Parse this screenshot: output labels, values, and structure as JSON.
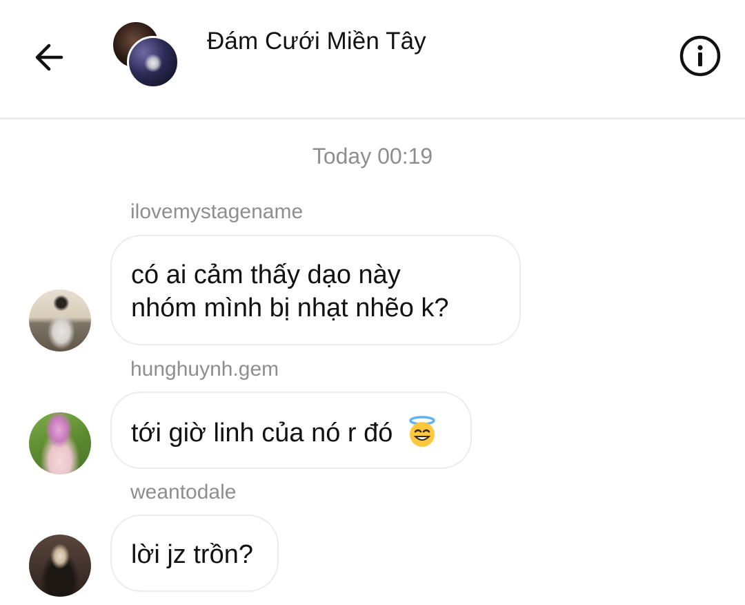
{
  "header": {
    "title": "Đám Cưới Miền Tây",
    "back_icon": "arrow-left-icon",
    "info_icon": "info-icon"
  },
  "timestamp": "Today 00:19",
  "messages": [
    {
      "username": "ilovemystagename",
      "lines": [
        "có ai cảm thấy dạo này",
        "nhóm mình bị nhạt nhẽo k?"
      ]
    },
    {
      "username": "hunghuynh.gem",
      "lines": [
        "tới giờ linh của nó r đó"
      ],
      "emoji": "😇"
    },
    {
      "username": "weantodale",
      "lines": [
        "lời jz trồn?"
      ]
    }
  ],
  "colors": {
    "text": "#111111",
    "meta_text": "#8e8e8e",
    "bubble_border": "#ececec",
    "emoji_face": "#ffc83d"
  }
}
